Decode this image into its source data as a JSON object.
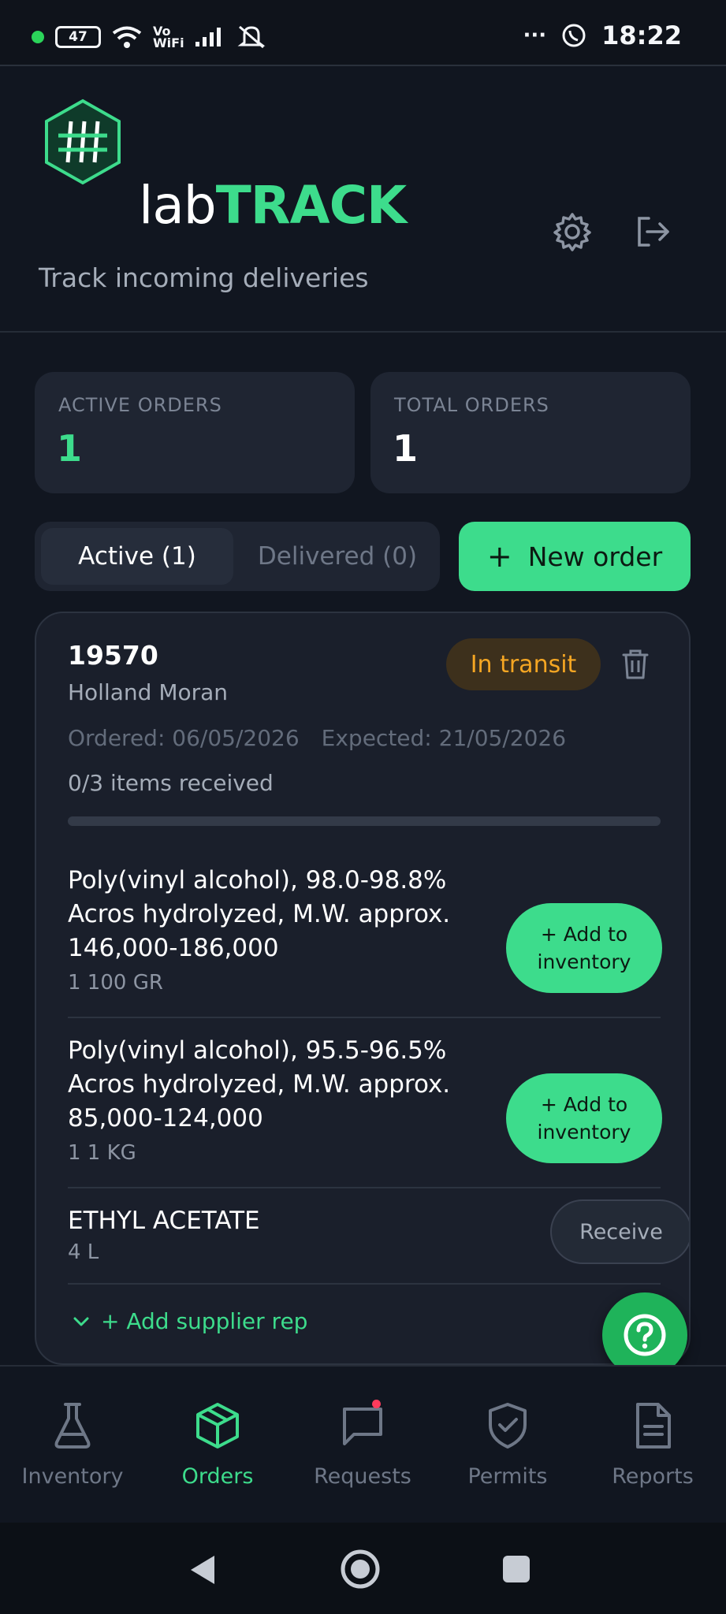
{
  "status_bar": {
    "battery": "47",
    "wifi_label": "Vo WiFi",
    "time": "18:22",
    "overflow": "···"
  },
  "app": {
    "brand_prefix": "lab",
    "brand_suffix": "TRACK",
    "subtitle": "Track incoming deliveries"
  },
  "stats": [
    {
      "label": "ACTIVE ORDERS",
      "value": "1",
      "color": "#3ddc8c"
    },
    {
      "label": "TOTAL ORDERS",
      "value": "1",
      "color": "#ffffff"
    }
  ],
  "tabs": {
    "active": "Active (1)",
    "delivered": "Delivered (0)"
  },
  "new_order": {
    "plus": "+",
    "label": "New order"
  },
  "order": {
    "number": "19570",
    "supplier": "Holland Moran",
    "status": "In transit",
    "ordered": "Ordered: 06/05/2026",
    "expected": "Expected: 21/05/2026",
    "received_text": "0/3 items received",
    "received_fraction": 0,
    "items": [
      {
        "name": "Poly(vinyl alcohol), 98.0-98.8% Acros hydrolyzed, M.W. approx. 146,000-186,000",
        "qty": "1 100 GR",
        "action": "+ Add to inventory"
      },
      {
        "name": "Poly(vinyl alcohol), 95.5-96.5% Acros hydrolyzed, M.W. approx. 85,000-124,000",
        "qty": "1 1 KG",
        "action": "+ Add to inventory"
      },
      {
        "name": "ETHYL ACETATE",
        "qty": "4 L",
        "action": "Receive"
      }
    ],
    "add_rep": "+ Add supplier rep"
  },
  "nav": [
    {
      "label": "Inventory",
      "icon": "flask-icon"
    },
    {
      "label": "Orders",
      "icon": "box-icon"
    },
    {
      "label": "Requests",
      "icon": "message-icon"
    },
    {
      "label": "Permits",
      "icon": "shield-check-icon"
    },
    {
      "label": "Reports",
      "icon": "document-icon"
    }
  ],
  "colors": {
    "accent": "#3ddc8c",
    "background": "#111620",
    "card": "#1a1f2b",
    "warning": "#f5a623"
  }
}
